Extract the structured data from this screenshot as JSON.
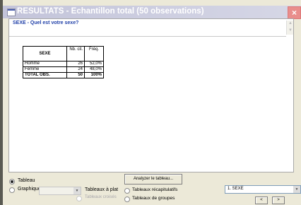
{
  "window": {
    "title": "RESULTATS - Echantillon total (50 observations)",
    "close_glyph": "×"
  },
  "question": "SEXE - Quel est votre sexe?",
  "table": {
    "header": {
      "variable": "SEXE",
      "n": "Nb. cit.",
      "freq": "Fréq."
    },
    "rows": [
      {
        "label": "Homme",
        "n": "26",
        "freq": "52,0%"
      },
      {
        "label": "Femme",
        "n": "24",
        "freq": "48,0%"
      }
    ],
    "total": {
      "label": "TOTAL OBS.",
      "n": "50",
      "freq": "100%"
    }
  },
  "controls": {
    "analyze_button": "Analyzer le tableau...",
    "radio_tableau": "Tableau",
    "radio_graphique": "Graphique",
    "graphique_select_value": "",
    "option_tableaux_a_plat": "Tableaux à plat",
    "option_tableaux_croises": "Tableaux croisés",
    "option_tableaux_recap": "Tableaux récapitulatifs",
    "option_tableaux_groupes": "Tableaux de groupes",
    "variable_select_value": "1. SEXE",
    "prev_button": "<",
    "next_button": ">"
  }
}
